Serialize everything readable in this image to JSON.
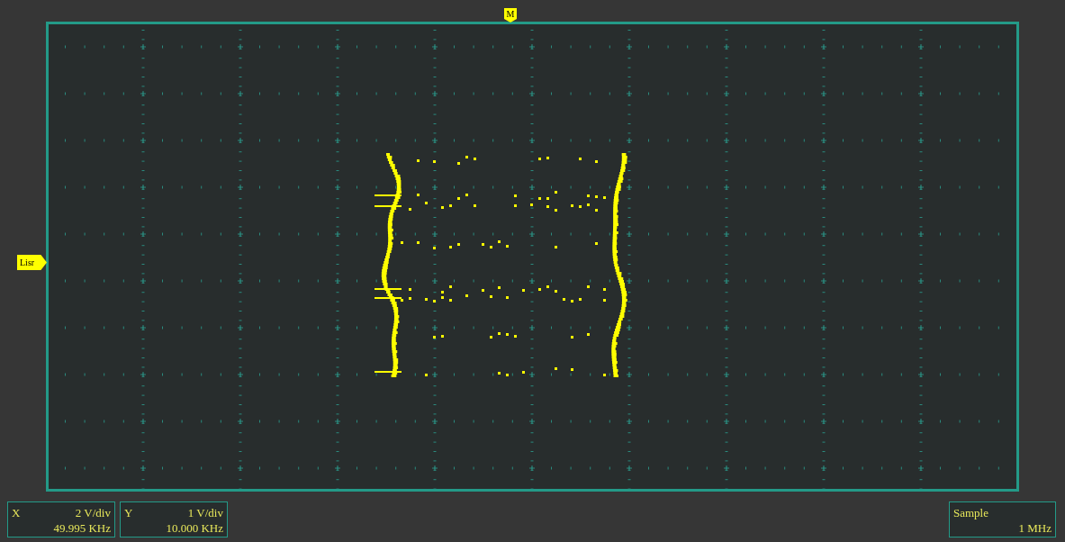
{
  "markers": {
    "trigger": "M",
    "channel": "Lisr"
  },
  "readouts": [
    {
      "label": "X",
      "scale": "2 V/div",
      "frequency": "49.995 KHz"
    },
    {
      "label": "Y",
      "scale": "1 V/div",
      "frequency": "10.000 KHz"
    }
  ],
  "acquisition": {
    "mode": "Sample",
    "rate": "1 MHz"
  }
}
